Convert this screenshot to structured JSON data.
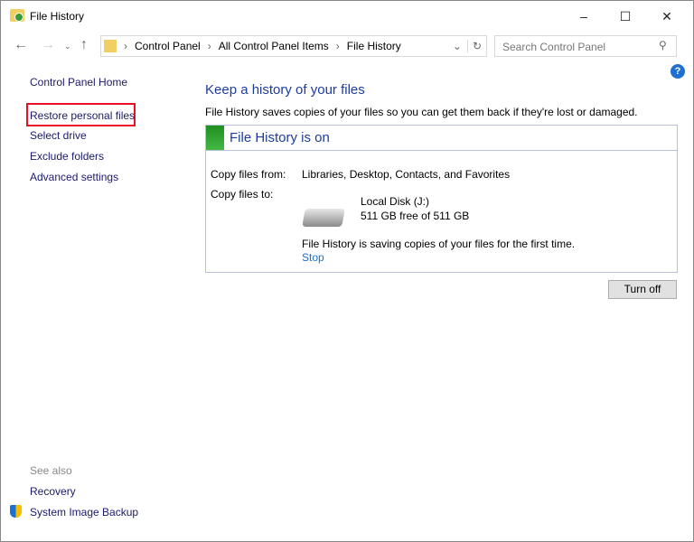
{
  "window": {
    "title": "File History"
  },
  "toolbar": {
    "breadcrumb": [
      "Control Panel",
      "All Control Panel Items",
      "File History"
    ],
    "search_placeholder": "Search Control Panel"
  },
  "sidebar": {
    "items": [
      "Control Panel Home",
      "Restore personal files",
      "Select drive",
      "Exclude folders",
      "Advanced settings"
    ],
    "see_also": "See also",
    "see_also_items": [
      "Recovery",
      "System Image Backup"
    ]
  },
  "main": {
    "heading": "Keep a history of your files",
    "description": "File History saves copies of your files so you can get them back if they're lost or damaged.",
    "status": "File History is on",
    "from_label": "Copy files from:",
    "from_value": "Libraries, Desktop, Contacts, and Favorites",
    "to_label": "Copy files to:",
    "drive_name": "Local Disk (J:)",
    "drive_space": "511 GB free of 511 GB",
    "progress_text": "File History is saving copies of your files for the first time.",
    "stop_link": "Stop",
    "turn_off": "Turn off"
  },
  "colors": {
    "highlight": "#e81123",
    "accent": "#1e3c9c",
    "link": "#1e6fd0"
  }
}
